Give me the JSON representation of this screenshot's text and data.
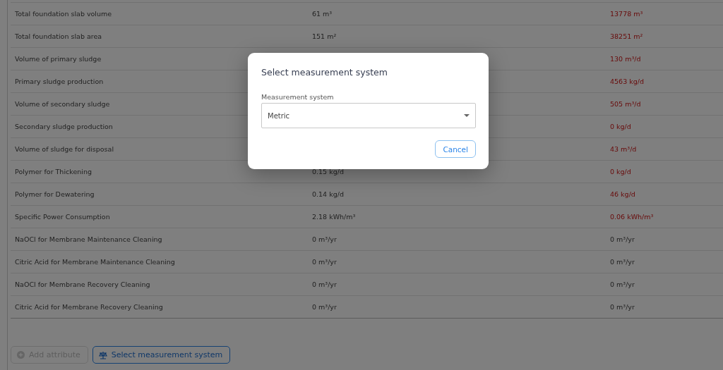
{
  "table": {
    "rows": [
      {
        "label": "Total foundation slab volume",
        "value": "61 m³",
        "comparison": "13778 m³",
        "warning": true
      },
      {
        "label": "Total foundation slab area",
        "value": "151 m²",
        "comparison": "38251 m²",
        "warning": true
      },
      {
        "label": "Volume of primary sludge",
        "comparison": "130 m³/d",
        "warning": true
      },
      {
        "label": "Primary sludge production",
        "comparison": "4563 kg/d",
        "warning": true
      },
      {
        "label": "Volume of secondary sludge",
        "comparison": "505 m³/d",
        "warning": true
      },
      {
        "label": "Secondary sludge production",
        "comparison": "0 kg/d",
        "warning": true
      },
      {
        "label": "Volume of sludge for disposal",
        "comparison": "43 m³/d",
        "warning": true
      },
      {
        "label": "Polymer for Thickening",
        "value": "0.15 kg/d",
        "comparison": "0 kg/d",
        "warning": true
      },
      {
        "label": "Polymer for Dewatering",
        "value": "0.14 kg/d",
        "comparison": "46 kg/d",
        "warning": true
      },
      {
        "label": "Specific Power Consumption",
        "value": "2.18 kWh/m³",
        "comparison": "0.06 kWh/m³",
        "warning": true
      },
      {
        "label": "NaOCl for Membrane Maintenance Cleaning",
        "value": "0 m³/yr",
        "comparison": "0 m³/yr",
        "warning": false
      },
      {
        "label": "Citric Acid for Membrane Maintenance Cleaning",
        "value": "0 m³/yr",
        "comparison": "0 m³/yr",
        "warning": false
      },
      {
        "label": "NaOCl for Membrane Recovery Cleaning",
        "value": "0 m³/yr",
        "comparison": "0 m³/yr",
        "warning": false
      },
      {
        "label": "Citric Acid for Membrane Recovery Cleaning",
        "value": "0 m³/yr",
        "comparison": "0 m³/yr",
        "warning": false
      }
    ]
  },
  "actions": [
    {
      "label": "Add attribute",
      "kind": "add",
      "disabled": true
    },
    {
      "label": "Select measurement system",
      "kind": "measure",
      "disabled": false
    }
  ],
  "dialog": {
    "title": "Select measurement system",
    "field_label": "Measurement system",
    "value": "Metric",
    "button": "Cancel"
  }
}
